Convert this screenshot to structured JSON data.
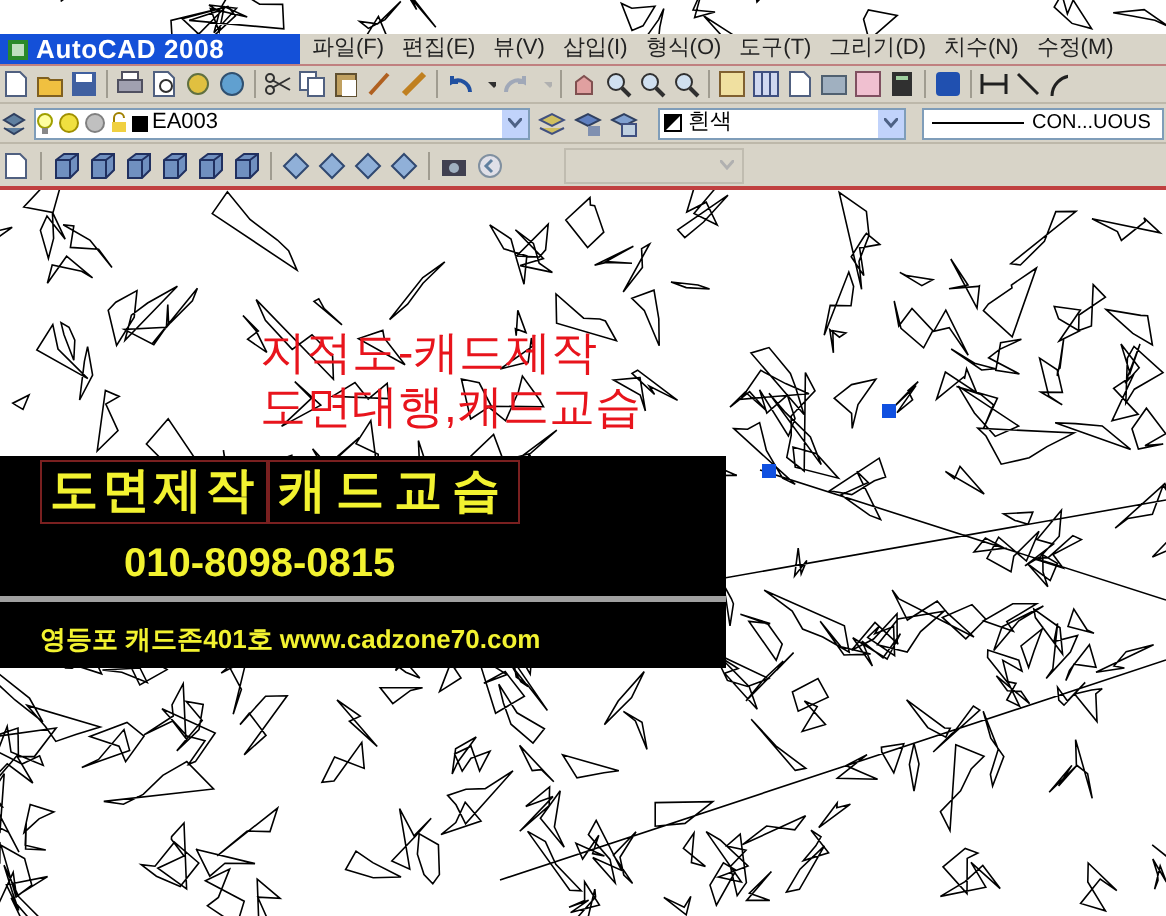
{
  "window": {
    "title": "AutoCAD 2008"
  },
  "menu": [
    "파일(F)",
    "편집(E)",
    "뷰(V)",
    "삽입(I)",
    "형식(O)",
    "도구(T)",
    "그리기(D)",
    "치수(N)",
    "수정(M)"
  ],
  "layer_control": {
    "value": "EA003"
  },
  "color_control": {
    "value": "흰색"
  },
  "linetype_control": {
    "value": "CON...UOUS"
  },
  "overlay_text": [
    "지적도-캐드제작",
    "도면대행,캐드교습"
  ],
  "banner": {
    "headline": [
      "도면제작",
      "캐드교습"
    ],
    "phone": "010-8098-0815",
    "address": "영등포 캐드존401호 www.cadzone70.com"
  }
}
